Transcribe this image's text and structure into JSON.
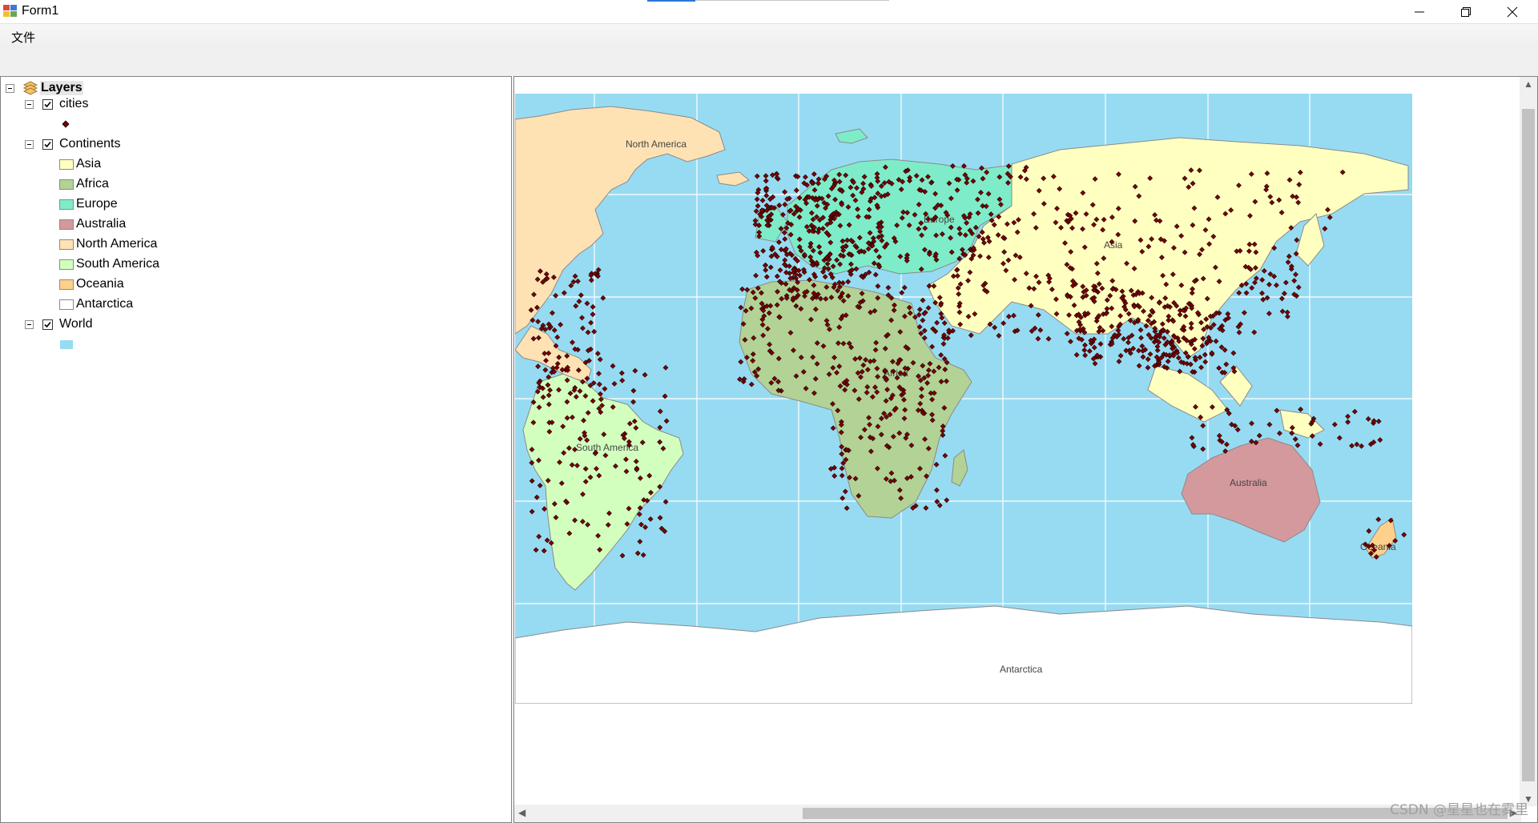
{
  "window": {
    "title": "Form1"
  },
  "menu": {
    "file_label": "文件"
  },
  "toc": {
    "root_label": "Layers",
    "layers": [
      {
        "name": "cities",
        "checked": true,
        "legend": [
          {
            "label": "",
            "symbol": "point",
            "color": "#8b0000"
          }
        ]
      },
      {
        "name": "Continents",
        "checked": true,
        "legend": [
          {
            "label": "Asia",
            "color": "#ffffc0"
          },
          {
            "label": "Africa",
            "color": "#b2d296"
          },
          {
            "label": "Europe",
            "color": "#7eecc8"
          },
          {
            "label": "Australia",
            "color": "#d4999c"
          },
          {
            "label": "North America",
            "color": "#ffe2b4"
          },
          {
            "label": "South America",
            "color": "#d2ffbe"
          },
          {
            "label": "Oceania",
            "color": "#ffd08c"
          },
          {
            "label": "Antarctica",
            "color": "#ffffff"
          }
        ]
      },
      {
        "name": "World",
        "checked": true,
        "legend": [
          {
            "label": "",
            "color": "#97dbf2"
          }
        ]
      }
    ]
  },
  "map": {
    "ocean_color": "#97dbf2",
    "city_color": "#7b0000",
    "labels": {
      "north_america": "North America",
      "europe": "Europe",
      "asia": "Asia",
      "africa": "Africa",
      "south_america": "South America",
      "australia": "Australia",
      "oceania": "Oceania",
      "antarctica": "Antarctica"
    }
  },
  "watermark": "CSDN @星星也在雾里"
}
